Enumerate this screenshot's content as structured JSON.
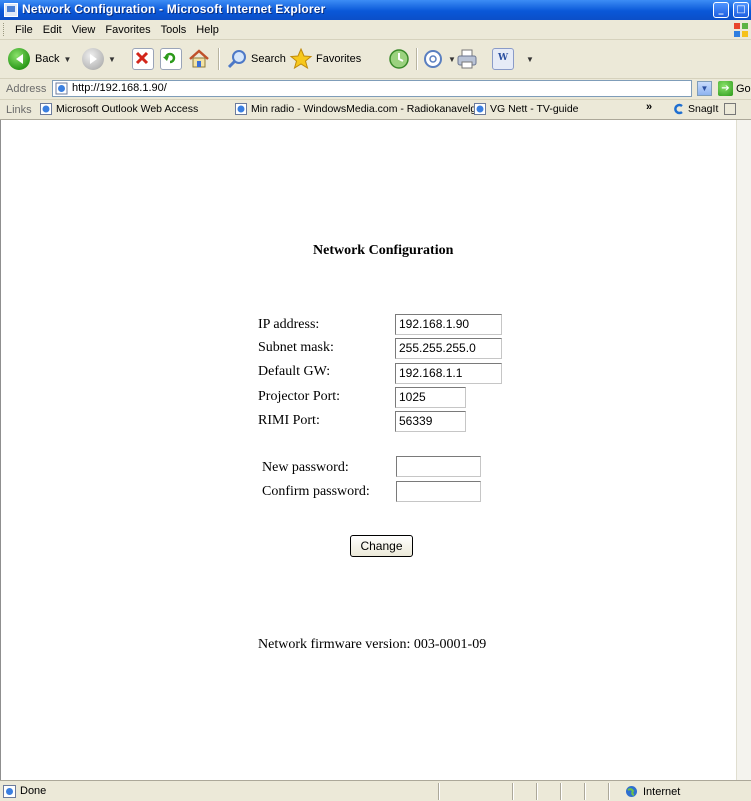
{
  "window": {
    "title": "Network Configuration - Microsoft Internet Explorer",
    "controls": {
      "minimize": "_",
      "maximize": "□"
    }
  },
  "menu": [
    "File",
    "Edit",
    "View",
    "Favorites",
    "Tools",
    "Help"
  ],
  "toolbar": {
    "back_label": "Back",
    "search_label": "Search",
    "favorites_label": "Favorites"
  },
  "address": {
    "label": "Address",
    "url": "http://192.168.1.90/",
    "go_label": "Go"
  },
  "links": {
    "label": "Links",
    "items": [
      "Microsoft Outlook Web Access",
      "Min radio - WindowsMedia.com - Radiokanavelger",
      "VG Nett - TV-guide"
    ],
    "overflow": "»",
    "snagit_label": "SnagIt"
  },
  "form": {
    "heading": "Network Configuration",
    "ip_label": "IP address:",
    "ip_value": "192.168.1.90",
    "subnet_label": "Subnet mask:",
    "subnet_value": "255.255.255.0",
    "gateway_label": "Default GW:",
    "gateway_value": "192.168.1.1",
    "projector_port_label": "Projector Port:",
    "projector_port_value": "1025",
    "rimi_port_label": "RIMI Port:",
    "rimi_port_value": "56339",
    "new_password_label": "New password:",
    "new_password_value": "",
    "confirm_password_label": "Confirm password:",
    "confirm_password_value": "",
    "change_button": "Change",
    "firmware_version": "Network firmware version: 003-0001-09"
  },
  "status": {
    "text": "Done",
    "zone": "Internet"
  },
  "colors": {
    "titlebar": "#0a58d8",
    "chrome": "#ece9d8",
    "page_background": "#ffffff"
  }
}
